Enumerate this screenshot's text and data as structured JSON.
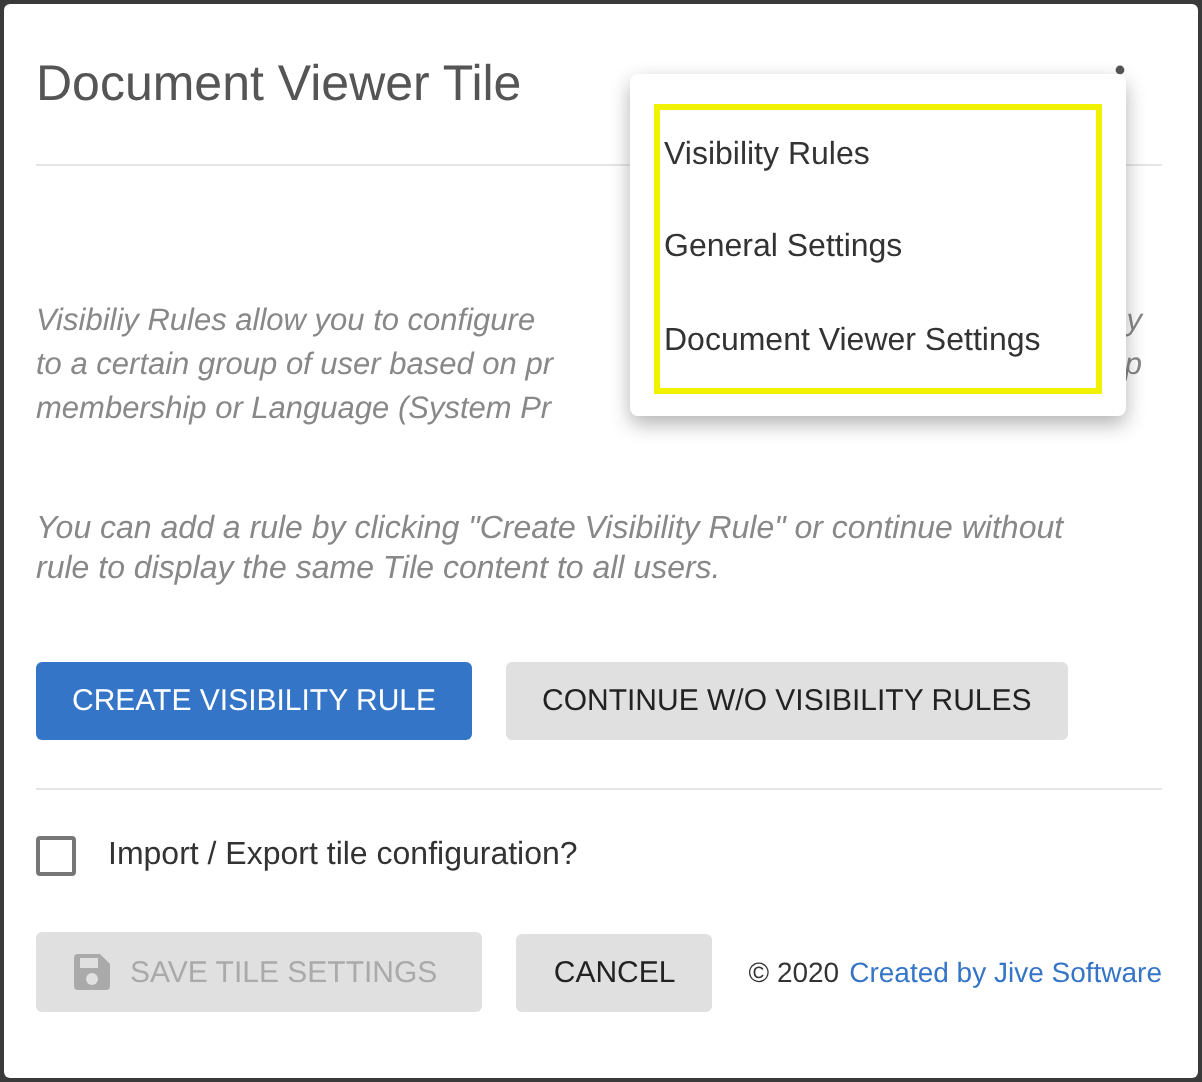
{
  "dialog": {
    "title": "Document Viewer Tile",
    "intro_lines": [
      {
        "text": "Visibiliy Rules allow you to configure",
        "tail": "y"
      },
      {
        "text": "to a certain group of user based on pr",
        "tail": "p"
      },
      {
        "text": "membership or Language (System Pr"
      }
    ],
    "hint": "You can add a rule by clicking \"Create Visibility Rule\" or continue without rule to display the same Tile content to all users.",
    "actions": [
      {
        "label": "CREATE VISIBILITY RULE",
        "kind": "primary"
      },
      {
        "label": "CONTINUE W/O VISIBILITY RULES",
        "kind": "secondary"
      }
    ],
    "import_export": {
      "label": "Import / Export tile configuration?",
      "checked": false
    },
    "save_button": {
      "label": "SAVE TILE SETTINGS",
      "disabled": true
    },
    "cancel_button": {
      "label": "CANCEL"
    },
    "copyright": "© 2020",
    "credit_link": "Created by Jive Software"
  },
  "menu": {
    "items": [
      {
        "label": "Visibility Rules"
      },
      {
        "label": "General Settings"
      },
      {
        "label": "Document Viewer Settings"
      }
    ],
    "highlighted": true
  }
}
